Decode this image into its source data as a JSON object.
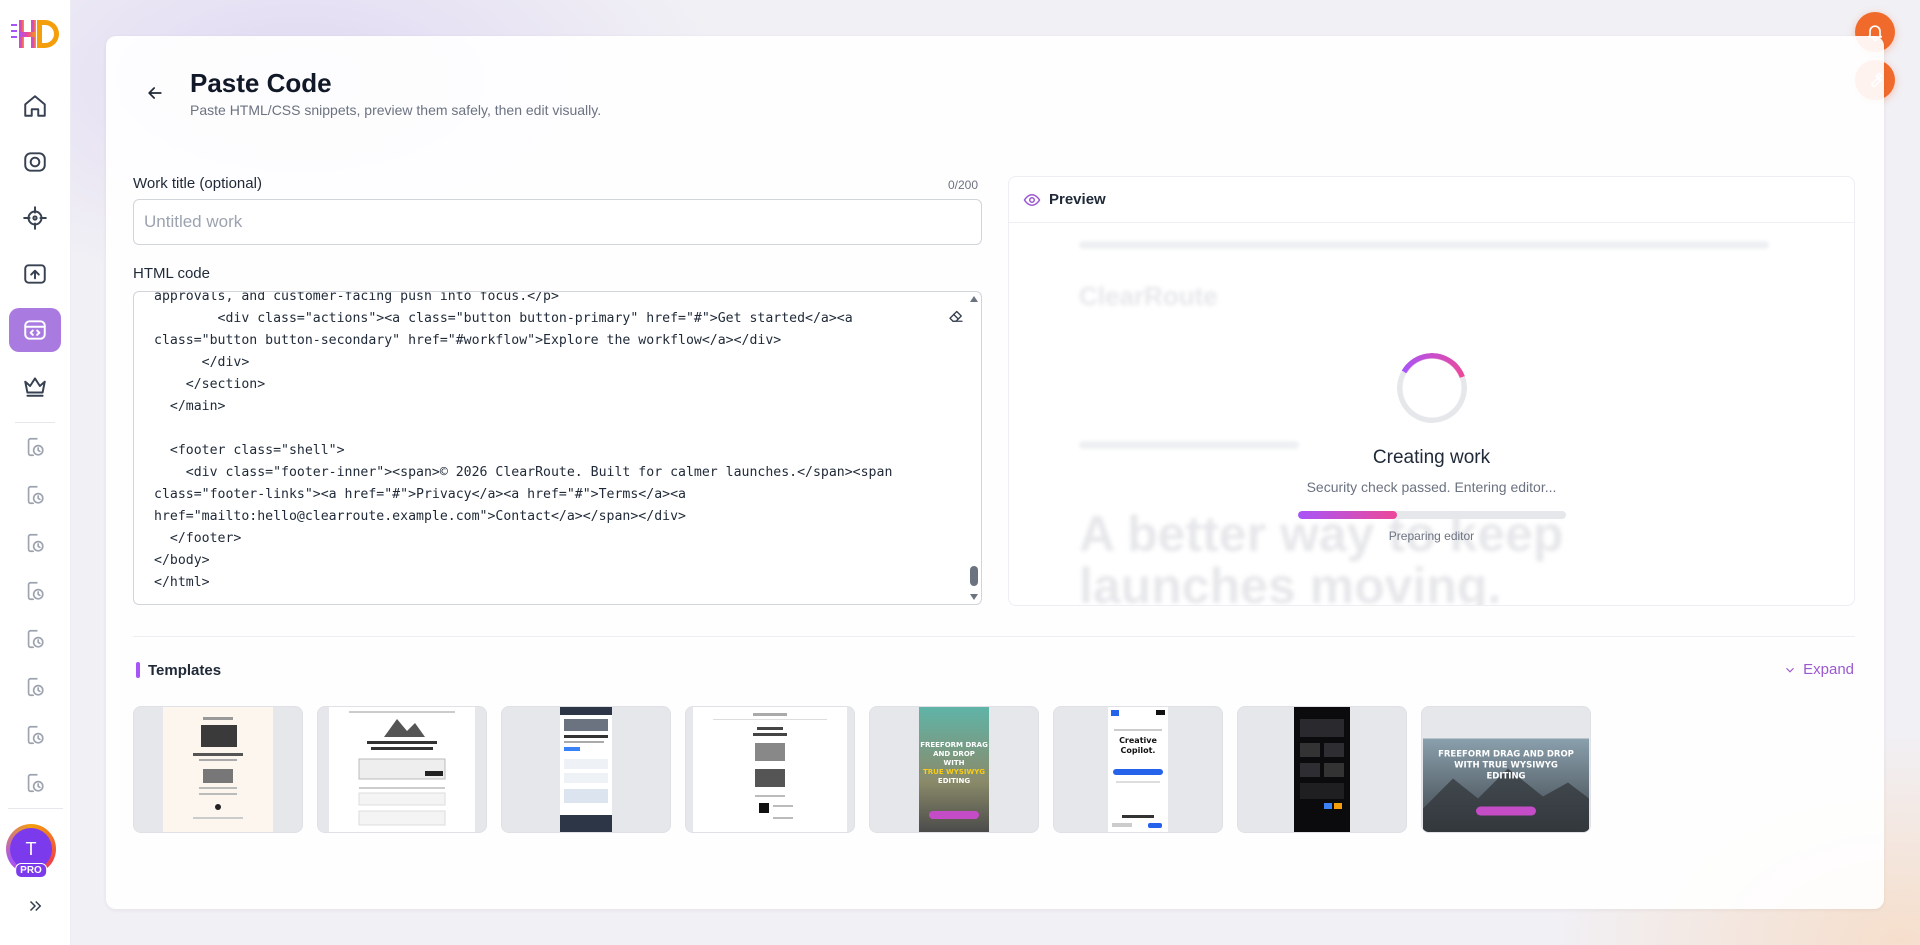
{
  "app": {
    "logo_text": "HD"
  },
  "sidebar": {
    "nav": [
      {
        "name": "home-icon"
      },
      {
        "name": "camera-icon"
      },
      {
        "name": "target-icon"
      },
      {
        "name": "upload-icon"
      },
      {
        "name": "code-icon",
        "active": true
      },
      {
        "name": "crown-icon"
      }
    ],
    "history_count": 8,
    "avatar_initial": "T",
    "pro_label": "PRO"
  },
  "header": {
    "title": "Paste Code",
    "subtitle": "Paste HTML/CSS snippets, preview them safely, then edit visually."
  },
  "form": {
    "title_label": "Work title (optional)",
    "title_counter": "0/200",
    "title_placeholder": "Untitled work",
    "title_value": "",
    "code_label": "HTML code",
    "code_text": "approvals, and customer-facing push into focus.</p>\n        <div class=\"actions\"><a class=\"button button-primary\" href=\"#\">Get started</a><a\nclass=\"button button-secondary\" href=\"#workflow\">Explore the workflow</a></div>\n      </div>\n    </section>\n  </main>\n\n  <footer class=\"shell\">\n    <div class=\"footer-inner\"><span>© 2026 ClearRoute. Built for calmer launches.</span><span\nclass=\"footer-links\"><a href=\"#\">Privacy</a><a href=\"#\">Terms</a><a\nhref=\"mailto:hello@clearroute.example.com\">Contact</a></span></div>\n  </footer>\n</body>\n</html>"
  },
  "preview": {
    "title": "Preview",
    "status_title": "Creating work",
    "status_message": "Security check passed. Entering editor...",
    "progress": 0.37,
    "progress_label": "Preparing editor",
    "background_brand": "ClearRoute",
    "background_headline": "A better way to keep launches moving."
  },
  "templates": {
    "title": "Templates",
    "expand_label": "Expand",
    "items": [
      {
        "name": "template-1",
        "theme": "light-beige"
      },
      {
        "name": "template-2",
        "theme": "white-mountain"
      },
      {
        "name": "template-3",
        "theme": "dark-header"
      },
      {
        "name": "template-4",
        "theme": "white-minimal"
      },
      {
        "name": "template-5",
        "theme": "freeform-teal"
      },
      {
        "name": "template-6",
        "theme": "creative-copilot"
      },
      {
        "name": "template-7",
        "theme": "dark"
      },
      {
        "name": "template-8",
        "theme": "freeform-wide"
      }
    ],
    "freeform_text": "FREEFORM DRAG AND DROP WITH TRUE WYSIWYG EDITING",
    "copilot_text": "Creative Copilot."
  },
  "colors": {
    "accent": "#a855f7",
    "fab": "#f06a2c"
  }
}
